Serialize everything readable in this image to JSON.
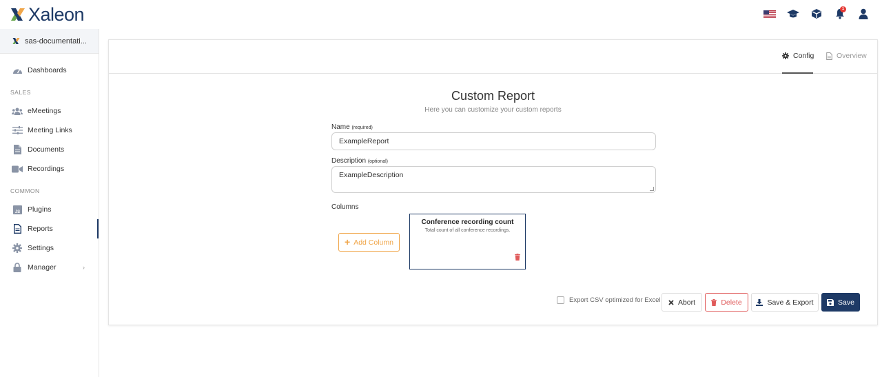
{
  "brand": {
    "name": "Xaleon"
  },
  "header": {
    "icons": [
      "us-flag-icon",
      "graduation-cap-icon",
      "cube-icon",
      "bell-icon",
      "user-icon"
    ],
    "notification_count": "1"
  },
  "sidebar": {
    "project": "sas-documentati...",
    "dashboards": "Dashboards",
    "sales_label": "SALES",
    "sales_items": [
      "eMeetings",
      "Meeting Links",
      "Documents",
      "Recordings"
    ],
    "common_label": "COMMON",
    "common_items": [
      "Plugins",
      "Reports",
      "Settings",
      "Manager"
    ],
    "active_item": "Reports"
  },
  "tabs": {
    "config": "Config",
    "overview": "Overview"
  },
  "form": {
    "title": "Custom Report",
    "subtitle": "Here you can customize your custom reports",
    "name_label": "Name",
    "name_hint": "(required)",
    "name_value": "ExampleReport",
    "desc_label": "Description",
    "desc_hint": "(optional)",
    "desc_value": "ExampleDescription",
    "columns_label": "Columns",
    "add_column": "Add Column",
    "column": {
      "title": "Conference recording count",
      "description": "Total count of all conference recordings."
    },
    "export_label": "Export CSV optimized for Excel"
  },
  "actions": {
    "abort": "Abort",
    "delete": "Delete",
    "save_export": "Save & Export",
    "save": "Save"
  },
  "colors": {
    "primary": "#1e3a66",
    "accent": "#f0a64a",
    "danger": "#e05a5a"
  }
}
